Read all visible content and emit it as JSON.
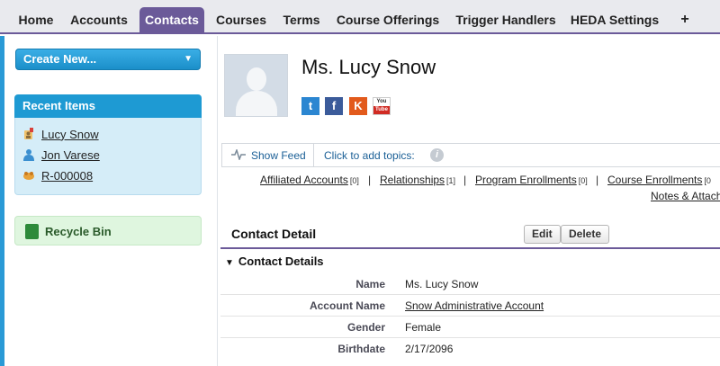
{
  "tabs": [
    {
      "label": "Home",
      "active": false
    },
    {
      "label": "Accounts",
      "active": false
    },
    {
      "label": "Contacts",
      "active": true
    },
    {
      "label": "Courses",
      "active": false
    },
    {
      "label": "Terms",
      "active": false
    },
    {
      "label": "Course Offerings",
      "active": false
    },
    {
      "label": "Trigger Handlers",
      "active": false
    },
    {
      "label": "HEDA Settings",
      "active": false
    },
    {
      "label": "+",
      "active": false
    }
  ],
  "sidebar": {
    "create_new": "Create New...",
    "recent_items_title": "Recent Items",
    "recent_items": [
      {
        "label": "Lucy Snow",
        "icon": "contact-card-icon"
      },
      {
        "label": "Jon Varese",
        "icon": "person-icon"
      },
      {
        "label": "R-000008",
        "icon": "relationship-icon"
      }
    ],
    "recycle_bin": "Recycle Bin"
  },
  "header": {
    "contact_name": "Ms. Lucy Snow",
    "social": {
      "twitter": "t",
      "facebook": "f",
      "klout": "K",
      "youtube_top": "You",
      "youtube_bottom": "Tube"
    }
  },
  "feed": {
    "show_feed": "Show Feed",
    "add_topics": "Click to add topics:",
    "info": "i"
  },
  "related_links": [
    {
      "label": "Affiliated Accounts",
      "count": "[0]"
    },
    {
      "label": "Relationships",
      "count": "[1]"
    },
    {
      "label": "Program Enrollments",
      "count": "[0]"
    },
    {
      "label": "Course Enrollments",
      "count": "[0"
    },
    {
      "label": "Notes & Attach",
      "count": ""
    }
  ],
  "separator": "|",
  "detail": {
    "title": "Contact Detail",
    "edit": "Edit",
    "delete": "Delete",
    "section": "Contact Details",
    "fields": [
      {
        "label": "Name",
        "value": "Ms. Lucy Snow",
        "link": false
      },
      {
        "label": "Account Name",
        "value": "Snow Administrative Account",
        "link": true
      },
      {
        "label": "Gender",
        "value": "Female",
        "link": false
      },
      {
        "label": "Birthdate",
        "value": "2/17/2096",
        "link": false
      }
    ]
  },
  "colors": {
    "accent": "#6b5a99",
    "sidebar_blue": "#1e9ad3",
    "link": "#1a5f96"
  }
}
